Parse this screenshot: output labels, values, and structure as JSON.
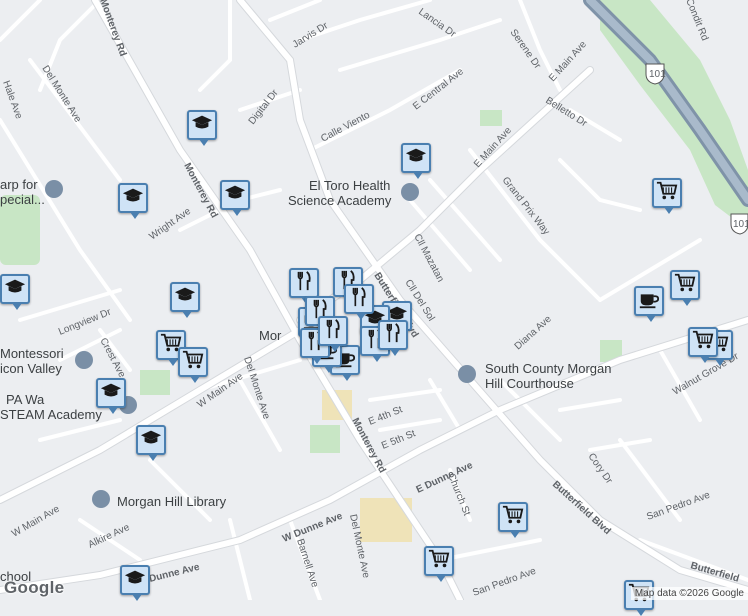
{
  "map": {
    "street_labels": [
      {
        "id": "monterey-rd-n",
        "text": "Monterey Rd"
      },
      {
        "id": "monterey-rd-mid",
        "text": "Monterey Rd"
      },
      {
        "id": "monterey-rd-s",
        "text": "Monterey Rd"
      },
      {
        "id": "jarvis-dr",
        "text": "Jarvis Dr"
      },
      {
        "id": "del-monte-ave-n",
        "text": "Del Monte Ave"
      },
      {
        "id": "del-monte-ave-mid",
        "text": "Del Monte Ave"
      },
      {
        "id": "del-monte-ave-s",
        "text": "Del Monte Ave"
      },
      {
        "id": "hale-ave",
        "text": "Hale Ave"
      },
      {
        "id": "digital-dr",
        "text": "Digital Dr"
      },
      {
        "id": "calle-viento",
        "text": "Calle Viento"
      },
      {
        "id": "e-central-ave",
        "text": "E Central Ave"
      },
      {
        "id": "lancia-dr",
        "text": "Lancia Dr"
      },
      {
        "id": "serene-dr",
        "text": "Serene Dr"
      },
      {
        "id": "e-main-ave-ne",
        "text": "E Main Ave"
      },
      {
        "id": "e-main-ave",
        "text": "E Main Ave"
      },
      {
        "id": "belletto-dr",
        "text": "Belletto Dr"
      },
      {
        "id": "condit-rd",
        "text": "Condit Rd"
      },
      {
        "id": "grand-prix-way",
        "text": "Grand Prix Way"
      },
      {
        "id": "wright-ave",
        "text": "Wright Ave"
      },
      {
        "id": "cll-mazatan",
        "text": "Cll Mazatan"
      },
      {
        "id": "cll-del-sol",
        "text": "Cll Del Sol"
      },
      {
        "id": "butterfield-blvd-n",
        "text": "Butterfield Blvd"
      },
      {
        "id": "butterfield-blvd-s",
        "text": "Butterfield Blvd"
      },
      {
        "id": "butterfield-blvd-se",
        "text": "Butterfield"
      },
      {
        "id": "longview-dr",
        "text": "Longview Dr"
      },
      {
        "id": "crest-ave",
        "text": "Crest Ave"
      },
      {
        "id": "w-main-ave",
        "text": "W Main Ave"
      },
      {
        "id": "w-main-ave-sw",
        "text": "W Main Ave"
      },
      {
        "id": "diana-ave",
        "text": "Diana Ave"
      },
      {
        "id": "walnut-grove-dr",
        "text": "Walnut Grove Dr"
      },
      {
        "id": "e-4th-st",
        "text": "E 4th St"
      },
      {
        "id": "e-5th-st",
        "text": "E 5th St"
      },
      {
        "id": "e-dunne-ave",
        "text": "E Dunne Ave"
      },
      {
        "id": "w-dunne-ave",
        "text": "W Dunne Ave"
      },
      {
        "id": "w-dunne-ave-sw",
        "text": "Dunne Ave"
      },
      {
        "id": "church-st",
        "text": "Church St"
      },
      {
        "id": "cory-dr",
        "text": "Cory Dr"
      },
      {
        "id": "san-pedro-ave-e",
        "text": "San Pedro Ave"
      },
      {
        "id": "san-pedro-ave-s",
        "text": "San Pedro Ave"
      },
      {
        "id": "alkire-ave",
        "text": "Alkire Ave"
      },
      {
        "id": "barnell-ave",
        "text": "Barnell Ave"
      },
      {
        "id": "hwy-101",
        "text": "101"
      },
      {
        "id": "hwy-101-edge",
        "text": "101"
      }
    ],
    "poi_labels": [
      {
        "id": "el-toro-1",
        "text": "El Toro Health"
      },
      {
        "id": "el-toro-2",
        "text": "Science Academy"
      },
      {
        "id": "courthouse-1",
        "text": "South County Morgan"
      },
      {
        "id": "courthouse-2",
        "text": "Hill Courthouse"
      },
      {
        "id": "montessori-1",
        "text": "Montessori"
      },
      {
        "id": "montessori-2",
        "text": "icon Valley"
      },
      {
        "id": "pa-walden",
        "text": "PA Wa"
      },
      {
        "id": "steam",
        "text": "STEAM Academy"
      },
      {
        "id": "harp-1",
        "text": "arp for"
      },
      {
        "id": "harp-2",
        "text": "pecial..."
      },
      {
        "id": "library",
        "text": "Morgan Hill Library"
      },
      {
        "id": "morgan-hill",
        "text": "Mor"
      },
      {
        "id": "school",
        "text": "chool"
      }
    ],
    "markers": [
      {
        "id": "school-1",
        "kind": "school",
        "icon": "graduation-cap-icon"
      },
      {
        "id": "school-2",
        "kind": "school",
        "icon": "graduation-cap-icon"
      },
      {
        "id": "school-3",
        "kind": "school",
        "icon": "graduation-cap-icon"
      },
      {
        "id": "school-4",
        "kind": "school",
        "icon": "graduation-cap-icon"
      },
      {
        "id": "school-5",
        "kind": "school",
        "icon": "graduation-cap-icon"
      },
      {
        "id": "school-6",
        "kind": "school",
        "icon": "graduation-cap-icon"
      },
      {
        "id": "school-7",
        "kind": "school",
        "icon": "graduation-cap-icon"
      },
      {
        "id": "school-8",
        "kind": "school",
        "icon": "graduation-cap-icon"
      },
      {
        "id": "school-9",
        "kind": "school",
        "icon": "graduation-cap-icon"
      },
      {
        "id": "school-10",
        "kind": "school",
        "icon": "graduation-cap-icon"
      },
      {
        "id": "school-11",
        "kind": "school",
        "icon": "graduation-cap-icon"
      },
      {
        "id": "grocery-1",
        "kind": "grocery",
        "icon": "shopping-cart-icon"
      },
      {
        "id": "grocery-2",
        "kind": "grocery",
        "icon": "shopping-cart-icon"
      },
      {
        "id": "grocery-3",
        "kind": "grocery",
        "icon": "shopping-cart-icon"
      },
      {
        "id": "grocery-4",
        "kind": "grocery",
        "icon": "shopping-cart-icon"
      },
      {
        "id": "grocery-5",
        "kind": "grocery",
        "icon": "shopping-cart-icon"
      },
      {
        "id": "grocery-6",
        "kind": "grocery",
        "icon": "shopping-cart-icon"
      },
      {
        "id": "grocery-7",
        "kind": "grocery",
        "icon": "shopping-cart-icon"
      },
      {
        "id": "grocery-8",
        "kind": "grocery",
        "icon": "shopping-cart-icon"
      },
      {
        "id": "grocery-9",
        "kind": "grocery",
        "icon": "shopping-cart-icon"
      },
      {
        "id": "cafe-1",
        "kind": "cafe",
        "icon": "coffee-cup-icon"
      },
      {
        "id": "cafe-2",
        "kind": "cafe",
        "icon": "coffee-cup-icon"
      },
      {
        "id": "cafe-3",
        "kind": "cafe",
        "icon": "coffee-cup-icon"
      },
      {
        "id": "cafe-4",
        "kind": "cafe",
        "icon": "coffee-cup-icon"
      },
      {
        "id": "restaurant-1",
        "kind": "restaurant",
        "icon": "fork-knife-icon"
      },
      {
        "id": "restaurant-2",
        "kind": "restaurant",
        "icon": "fork-knife-icon"
      },
      {
        "id": "restaurant-3",
        "kind": "restaurant",
        "icon": "fork-knife-icon"
      },
      {
        "id": "restaurant-4",
        "kind": "restaurant",
        "icon": "fork-knife-icon"
      },
      {
        "id": "restaurant-5",
        "kind": "restaurant",
        "icon": "fork-knife-icon"
      },
      {
        "id": "restaurant-6",
        "kind": "restaurant",
        "icon": "fork-knife-icon"
      },
      {
        "id": "restaurant-7",
        "kind": "restaurant",
        "icon": "fork-knife-icon"
      },
      {
        "id": "restaurant-8",
        "kind": "restaurant",
        "icon": "fork-knife-icon"
      }
    ],
    "attribution": "Map data ©2026 Google",
    "logo": "Google",
    "colors": {
      "background": "#eceef1",
      "road": "#ffffff",
      "road_outline": "#d5d8dc",
      "highway": "#8ea3b8",
      "park": "#c8e6c5",
      "sand": "#efe3b8",
      "marker_fill": "#cfe3f6",
      "marker_border": "#4a7fb0",
      "icon": "#1a1a1a"
    }
  }
}
